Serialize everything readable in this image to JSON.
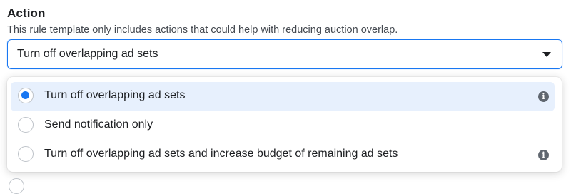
{
  "section": {
    "title": "Action",
    "description": "This rule template only includes actions that could help with reducing auction overlap."
  },
  "select": {
    "value": "Turn off overlapping ad sets",
    "caret_icon": "caret-down-icon"
  },
  "options": [
    {
      "label": "Turn off overlapping ad sets",
      "selected": true,
      "has_info": true
    },
    {
      "label": "Send notification only",
      "selected": false,
      "has_info": false
    },
    {
      "label": "Turn off overlapping ad sets and increase budget of remaining ad sets",
      "selected": false,
      "has_info": true
    }
  ],
  "info_icon_glyph": "i",
  "colors": {
    "accent": "#1877f2",
    "selected_bg": "#e7f0fd",
    "text": "#1c1e21",
    "muted_text": "#444950",
    "icon": "#606770"
  }
}
